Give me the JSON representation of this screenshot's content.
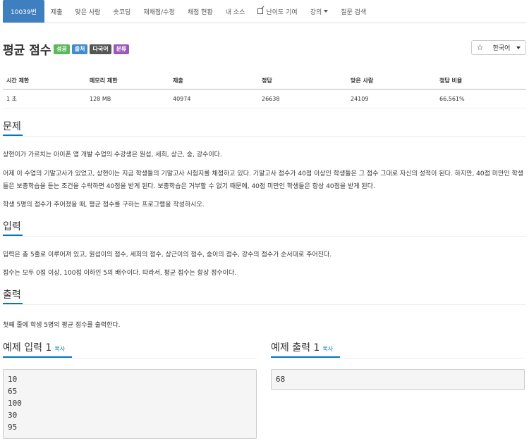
{
  "nav": {
    "tabs": [
      {
        "label": "10039번"
      },
      {
        "label": "제출"
      },
      {
        "label": "맞은 사람"
      },
      {
        "label": "숏코딩"
      },
      {
        "label": "재채점/수정"
      },
      {
        "label": "채점 현황"
      },
      {
        "label": "내 소스"
      },
      {
        "label": "난이도 기여"
      },
      {
        "label": "강의"
      },
      {
        "label": "질문 검색"
      }
    ],
    "active_color": "#3f7fbf"
  },
  "problem": {
    "title": "평균 점수",
    "labels": [
      {
        "text": "성공",
        "color": "#5cb85c"
      },
      {
        "text": "출처",
        "color": "#428bca"
      },
      {
        "text": "다국어",
        "color": "#555555"
      },
      {
        "text": "분류",
        "color": "#9b59b6"
      }
    ],
    "star_icon": "☆",
    "language": "한국어"
  },
  "info": {
    "headers": [
      "시간 제한",
      "메모리 제한",
      "제출",
      "정답",
      "맞은 사람",
      "정답 비율"
    ],
    "values": [
      "1 초",
      "128 MB",
      "40974",
      "26638",
      "24109",
      "66.561%"
    ]
  },
  "sections": {
    "description": {
      "heading": "문제",
      "paragraphs": [
        "상현이가 가르치는 아이폰 앱 개발 수업의 수강생은 원섭, 세희, 상근, 숭, 강수이다.",
        "어제 이 수업의 기말고사가 있었고, 상현이는 지금 학생들의 기말고사 시험지를 채점하고 있다. 기말고사 점수가 40점 이상인 학생들은 그 점수 그대로 자신의 성적이 된다. 하지만, 40점 미만인 학생들은 보충학습을 듣는 조건을 수락하면 40점을 받게 된다. 보충학습은 거부할 수 없기 때문에, 40점 미만인 학생들은 항상 40점을 받게 된다.",
        "학생 5명의 점수가 주어졌을 때, 평균 점수를 구하는 프로그램을 작성하시오."
      ]
    },
    "input": {
      "heading": "입력",
      "paragraphs": [
        "입력은 총 5줄로 이루어져 있고, 원섭이의 점수, 세희의 점수, 상근이의 점수, 숭이의 점수, 강수의 점수가 순서대로 주어진다.",
        "점수는 모두 0점 이상, 100점 이하인 5의 배수이다. 따라서, 평균 점수는 항상 정수이다."
      ]
    },
    "output": {
      "heading": "출력",
      "paragraphs": [
        "첫째 줄에 학생 5명의 평균 점수를 출력한다."
      ]
    }
  },
  "samples": {
    "input": {
      "heading": "예제 입력 1",
      "copy_label": "복사",
      "content": "10\n65\n100\n30\n95"
    },
    "output": {
      "heading": "예제 출력 1",
      "copy_label": "복사",
      "content": "68"
    }
  }
}
